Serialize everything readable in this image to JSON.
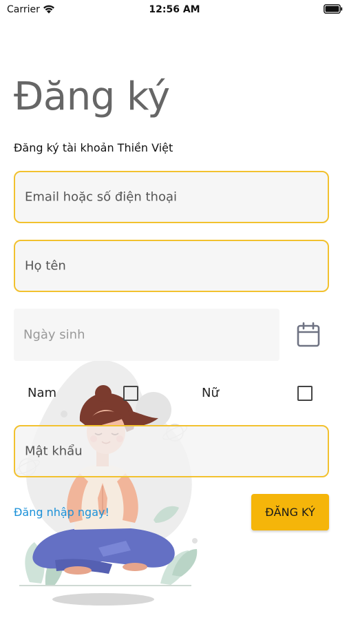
{
  "status_bar": {
    "carrier": "Carrier",
    "time": "12:56 AM",
    "wifi_icon": "wifi-icon",
    "battery_icon": "battery-icon"
  },
  "header": {
    "title": "Đăng ký",
    "subtitle": "Đăng ký tài khoản Thiền Việt"
  },
  "form": {
    "email_placeholder": "Email hoặc số điện thoại",
    "name_placeholder": "Họ tên",
    "birthday_placeholder": "Ngày sinh",
    "calendar_icon": "calendar-icon",
    "gender_male_label": "Nam",
    "gender_female_label": "Nữ",
    "gender_male_checked": false,
    "gender_female_checked": false,
    "password_placeholder": "Mật khẩu",
    "login_link": "Đăng nhập ngay!",
    "register_button": "ĐĂNG KÝ"
  },
  "colors": {
    "accent": "#f5b50a",
    "field_border": "#f2c12e",
    "link": "#1a90d8",
    "title": "#666666"
  },
  "illustration": {
    "name": "meditating-woman-illustration"
  }
}
